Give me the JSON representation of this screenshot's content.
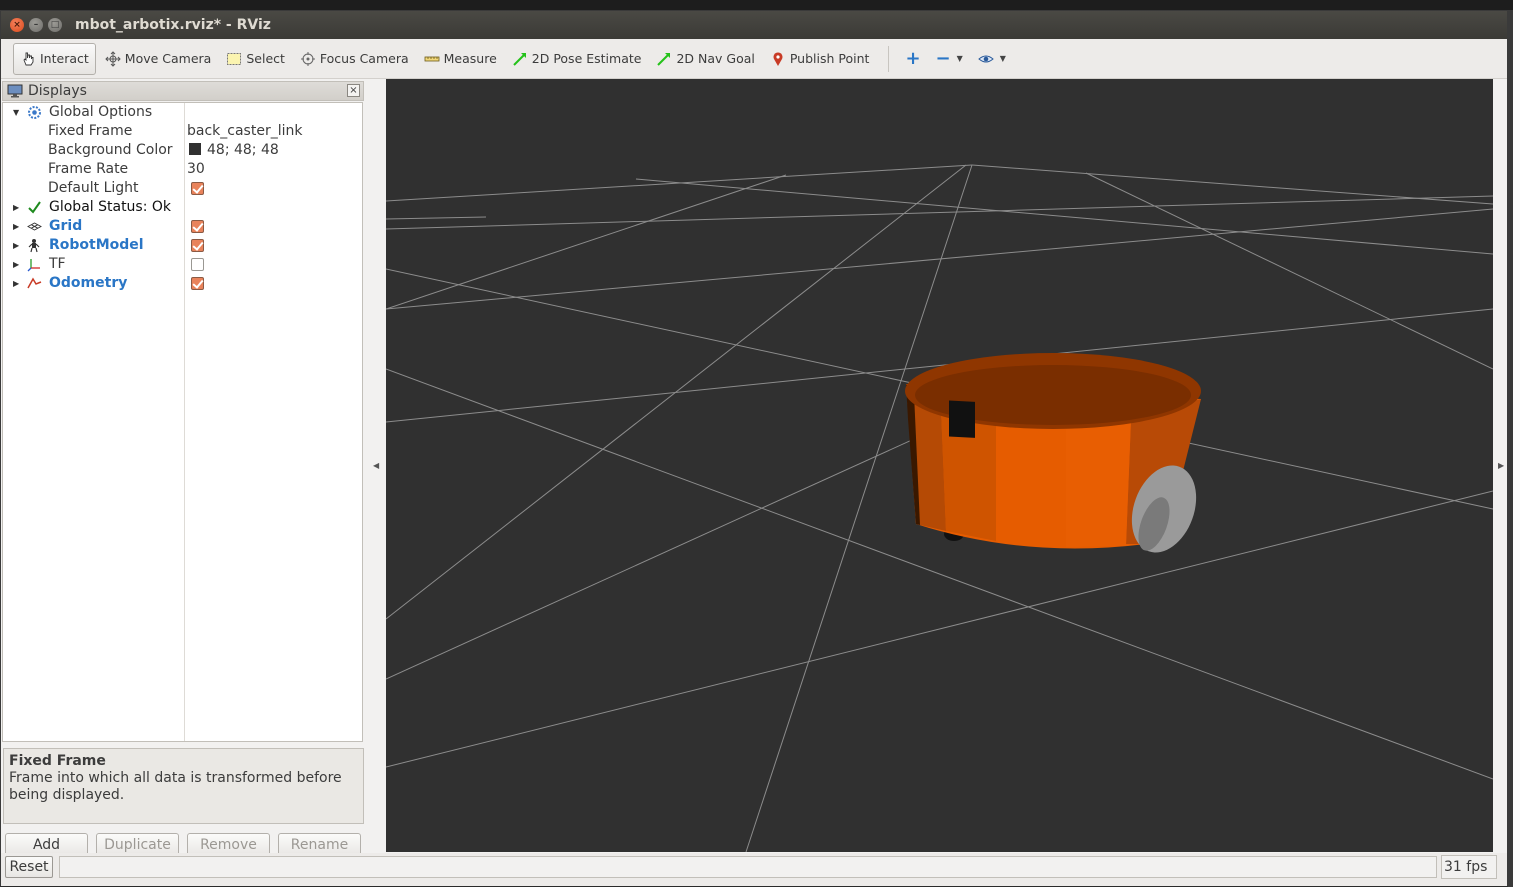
{
  "window": {
    "title": "mbot_arbotix.rviz* - RViz",
    "controls": {
      "close": "×",
      "minimize": "–",
      "maximize": "□"
    }
  },
  "toolbar": {
    "tools": [
      {
        "label": "Interact",
        "icon": "hand-pointer-icon",
        "active": true
      },
      {
        "label": "Move Camera",
        "icon": "move-camera-icon"
      },
      {
        "label": "Select",
        "icon": "select-box-icon"
      },
      {
        "label": "Focus Camera",
        "icon": "focus-camera-icon"
      },
      {
        "label": "Measure",
        "icon": "ruler-icon"
      },
      {
        "label": "2D Pose Estimate",
        "icon": "green-arrow-icon"
      },
      {
        "label": "2D Nav Goal",
        "icon": "green-arrow-icon"
      },
      {
        "label": "Publish Point",
        "icon": "map-pin-icon"
      }
    ],
    "add_tool": "+",
    "remove_tool": "−",
    "view_tool": "eye-icon"
  },
  "displays": {
    "header": "Displays",
    "close": "×",
    "rows": {
      "global_options": "Global Options",
      "fixed_frame_label": "Fixed Frame",
      "fixed_frame_value": "back_caster_link",
      "background_color_label": "Background Color",
      "background_color_value": "48; 48; 48",
      "frame_rate_label": "Frame Rate",
      "frame_rate_value": "30",
      "default_light_label": "Default Light",
      "global_status": "Global Status: Ok",
      "grid": "Grid",
      "robot_model": "RobotModel",
      "tf": "TF",
      "odometry": "Odometry"
    },
    "description": {
      "title": "Fixed Frame",
      "text": "Frame into which all data is transformed before being displayed."
    },
    "buttons": {
      "add": "Add",
      "duplicate": "Duplicate",
      "remove": "Remove",
      "rename": "Rename"
    }
  },
  "status": {
    "reset": "Reset",
    "fps": "31 fps"
  },
  "colors": {
    "viewport_bg": "#303030",
    "robot_orange": "#e65c00",
    "checkbox_orange": "#e9835b",
    "blue_label": "#2a76c6"
  }
}
